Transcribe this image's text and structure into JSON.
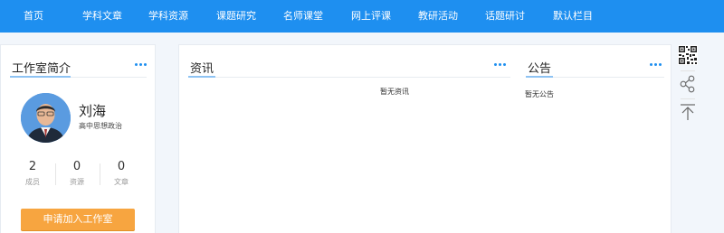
{
  "nav": {
    "items": [
      {
        "label": "首页"
      },
      {
        "label": "学科文章"
      },
      {
        "label": "学科资源"
      },
      {
        "label": "课题研究"
      },
      {
        "label": "名师课堂"
      },
      {
        "label": "网上评课"
      },
      {
        "label": "教研活动"
      },
      {
        "label": "话题研讨"
      },
      {
        "label": "默认栏目"
      }
    ]
  },
  "intro": {
    "title": "工作室简介",
    "name": "刘海",
    "subject": "高中思想政治",
    "stats": [
      {
        "value": "2",
        "label": "成员"
      },
      {
        "value": "0",
        "label": "资源"
      },
      {
        "value": "0",
        "label": "文章"
      }
    ],
    "join_label": "申请加入工作室"
  },
  "news": {
    "title": "资讯",
    "empty_text": "暂无资讯"
  },
  "notice": {
    "title": "公告",
    "empty_text": "暂无公告"
  },
  "side_tools": [
    "qr-code-icon",
    "share-icon",
    "back-to-top-icon"
  ],
  "colors": {
    "nav_bg": "#1e8ff0",
    "accent": "#1e8ff0",
    "join_button": "#f7a540",
    "page_bg": "#f2f6fb"
  }
}
